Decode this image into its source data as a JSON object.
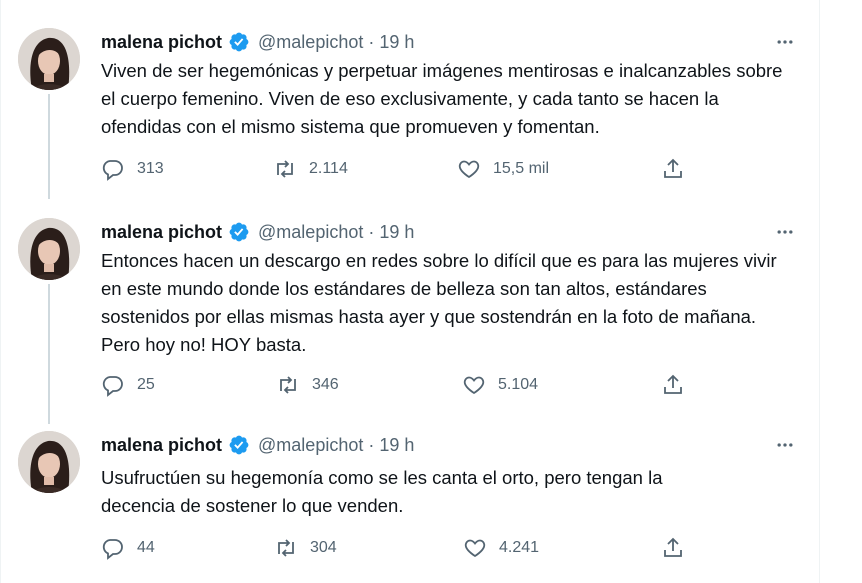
{
  "tweets": [
    {
      "author": {
        "name": "malena pichot",
        "handle": "@malepichot"
      },
      "time": "19 h",
      "separator": "·",
      "text": "Viven de ser hegemónicas y perpetuar imágenes mentirosas e inalcanzables sobre el cuerpo femenino. Viven de eso exclusivamente, y cada tanto se hacen la ofendidas con el mismo sistema que promueven y fomentan.",
      "replies": "313",
      "retweets": "2.114",
      "likes": "15,5 mil"
    },
    {
      "author": {
        "name": "malena pichot",
        "handle": "@malepichot"
      },
      "time": "19 h",
      "separator": "·",
      "text": "Entonces hacen un descargo en redes sobre lo difícil que es para las mujeres vivir en este mundo donde los estándares de belleza son tan altos, estándares sostenidos por ellas mismas hasta ayer y que sostendrán en la foto de mañana. Pero hoy no! HOY basta.",
      "replies": "25",
      "retweets": "346",
      "likes": "5.104"
    },
    {
      "author": {
        "name": "malena pichot",
        "handle": "@malepichot"
      },
      "time": "19 h",
      "separator": "·",
      "text": "Usufructúen su hegemonía como se les canta el orto, pero tengan la decencia de sostener lo que venden.",
      "replies": "44",
      "retweets": "304",
      "likes": "4.241"
    }
  ],
  "icons": {
    "verified": "verified-badge-icon",
    "more": "more-options-icon",
    "reply": "reply-icon",
    "retweet": "retweet-icon",
    "like": "like-icon",
    "share": "share-icon"
  },
  "colors": {
    "verified": "#1d9bf0",
    "muted": "#536471",
    "thread_line": "#cfd9de"
  }
}
